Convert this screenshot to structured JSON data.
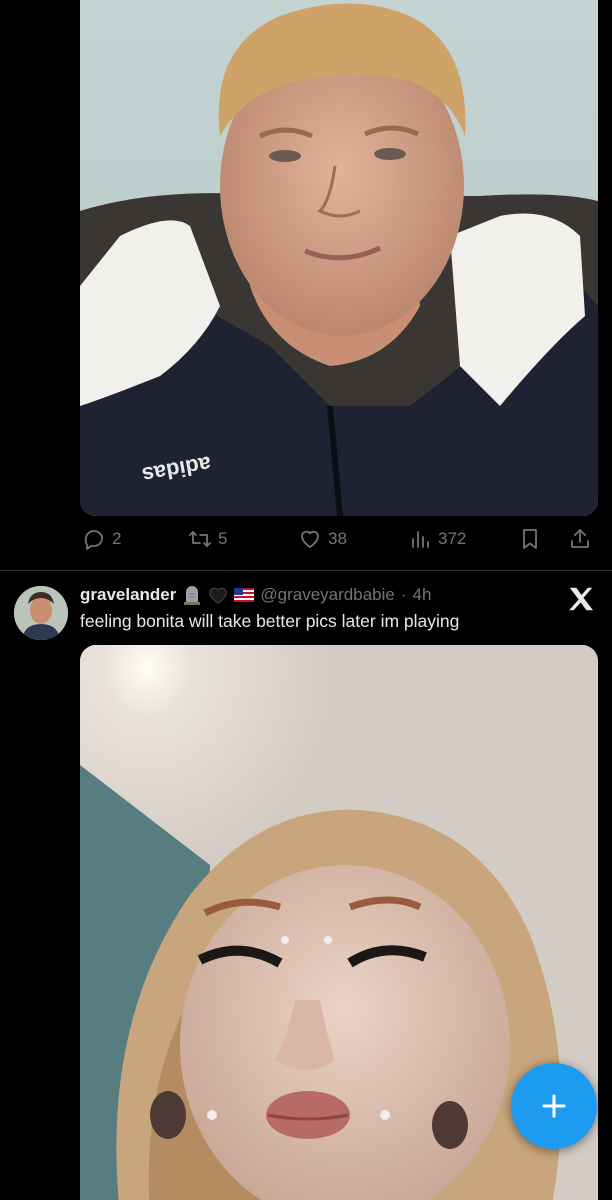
{
  "previous_tweet": {
    "media_alt": "selfie photo",
    "actions": {
      "reply_count": "2",
      "retweet_count": "5",
      "like_count": "38",
      "view_count": "372"
    }
  },
  "tweet": {
    "display_name": "gravelander",
    "name_emojis": [
      "headstone",
      "black-heart",
      "us-flag"
    ],
    "handle": "@graveyardbabie",
    "separator": "·",
    "time": "4h",
    "text": "feeling bonita will take better pics later im playing",
    "media_alt": "selfie photo"
  },
  "colors": {
    "background": "#000000",
    "primary_text": "#e7e9ea",
    "secondary_text": "#71767b",
    "accent": "#1d9bf0",
    "divider": "#2f3336"
  },
  "icons": {
    "reply": "reply-icon",
    "retweet": "retweet-icon",
    "like": "heart-icon",
    "views": "views-icon",
    "bookmark": "bookmark-icon",
    "share": "share-icon",
    "x_logo": "x-logo-icon",
    "compose": "plus-icon"
  }
}
